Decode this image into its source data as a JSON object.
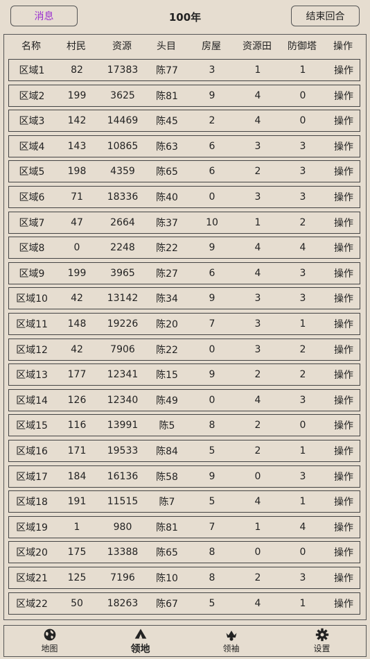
{
  "topbar": {
    "message_label": "消息",
    "year_label": "100年",
    "end_turn_label": "结束回合"
  },
  "table": {
    "headers": [
      "名称",
      "村民",
      "资源",
      "头目",
      "房屋",
      "资源田",
      "防御塔",
      "操作"
    ],
    "rows": [
      {
        "name": "区域1",
        "villagers": "82",
        "resources": "17383",
        "leader": "陈77",
        "houses": "3",
        "fields": "1",
        "towers": "1",
        "action": "操作"
      },
      {
        "name": "区域2",
        "villagers": "199",
        "resources": "3625",
        "leader": "陈81",
        "houses": "9",
        "fields": "4",
        "towers": "0",
        "action": "操作"
      },
      {
        "name": "区域3",
        "villagers": "142",
        "resources": "14469",
        "leader": "陈45",
        "houses": "2",
        "fields": "4",
        "towers": "0",
        "action": "操作"
      },
      {
        "name": "区域4",
        "villagers": "143",
        "resources": "10865",
        "leader": "陈63",
        "houses": "6",
        "fields": "3",
        "towers": "3",
        "action": "操作"
      },
      {
        "name": "区域5",
        "villagers": "198",
        "resources": "4359",
        "leader": "陈65",
        "houses": "6",
        "fields": "2",
        "towers": "3",
        "action": "操作"
      },
      {
        "name": "区域6",
        "villagers": "71",
        "resources": "18336",
        "leader": "陈40",
        "houses": "0",
        "fields": "3",
        "towers": "3",
        "action": "操作"
      },
      {
        "name": "区域7",
        "villagers": "47",
        "resources": "2664",
        "leader": "陈37",
        "houses": "10",
        "fields": "1",
        "towers": "2",
        "action": "操作"
      },
      {
        "name": "区域8",
        "villagers": "0",
        "resources": "2248",
        "leader": "陈22",
        "houses": "9",
        "fields": "4",
        "towers": "4",
        "action": "操作"
      },
      {
        "name": "区域9",
        "villagers": "199",
        "resources": "3965",
        "leader": "陈27",
        "houses": "6",
        "fields": "4",
        "towers": "3",
        "action": "操作"
      },
      {
        "name": "区域10",
        "villagers": "42",
        "resources": "13142",
        "leader": "陈34",
        "houses": "9",
        "fields": "3",
        "towers": "3",
        "action": "操作"
      },
      {
        "name": "区域11",
        "villagers": "148",
        "resources": "19226",
        "leader": "陈20",
        "houses": "7",
        "fields": "3",
        "towers": "1",
        "action": "操作"
      },
      {
        "name": "区域12",
        "villagers": "42",
        "resources": "7906",
        "leader": "陈22",
        "houses": "0",
        "fields": "3",
        "towers": "2",
        "action": "操作"
      },
      {
        "name": "区域13",
        "villagers": "177",
        "resources": "12341",
        "leader": "陈15",
        "houses": "9",
        "fields": "2",
        "towers": "2",
        "action": "操作"
      },
      {
        "name": "区域14",
        "villagers": "126",
        "resources": "12340",
        "leader": "陈49",
        "houses": "0",
        "fields": "4",
        "towers": "3",
        "action": "操作"
      },
      {
        "name": "区域15",
        "villagers": "116",
        "resources": "13991",
        "leader": "陈5",
        "houses": "8",
        "fields": "2",
        "towers": "0",
        "action": "操作"
      },
      {
        "name": "区域16",
        "villagers": "171",
        "resources": "19533",
        "leader": "陈84",
        "houses": "5",
        "fields": "2",
        "towers": "1",
        "action": "操作"
      },
      {
        "name": "区域17",
        "villagers": "184",
        "resources": "16136",
        "leader": "陈58",
        "houses": "9",
        "fields": "0",
        "towers": "3",
        "action": "操作"
      },
      {
        "name": "区域18",
        "villagers": "191",
        "resources": "11515",
        "leader": "陈7",
        "houses": "5",
        "fields": "4",
        "towers": "1",
        "action": "操作"
      },
      {
        "name": "区域19",
        "villagers": "1",
        "resources": "980",
        "leader": "陈81",
        "houses": "7",
        "fields": "1",
        "towers": "4",
        "action": "操作"
      },
      {
        "name": "区域20",
        "villagers": "175",
        "resources": "13388",
        "leader": "陈65",
        "houses": "8",
        "fields": "0",
        "towers": "0",
        "action": "操作"
      },
      {
        "name": "区域21",
        "villagers": "125",
        "resources": "7196",
        "leader": "陈10",
        "houses": "8",
        "fields": "2",
        "towers": "3",
        "action": "操作"
      },
      {
        "name": "区域22",
        "villagers": "50",
        "resources": "18263",
        "leader": "陈67",
        "houses": "5",
        "fields": "4",
        "towers": "1",
        "action": "操作"
      }
    ]
  },
  "bottom_nav": {
    "items": [
      {
        "label": "地图",
        "icon": "globe-icon",
        "active": false
      },
      {
        "label": "领地",
        "icon": "tent-icon",
        "active": true
      },
      {
        "label": "领袖",
        "icon": "crown-icon",
        "active": false
      },
      {
        "label": "设置",
        "icon": "gear-icon",
        "active": false
      }
    ]
  },
  "colors": {
    "background": "#e6ddd0",
    "message_text": "#9b30d0",
    "border": "#444444"
  }
}
